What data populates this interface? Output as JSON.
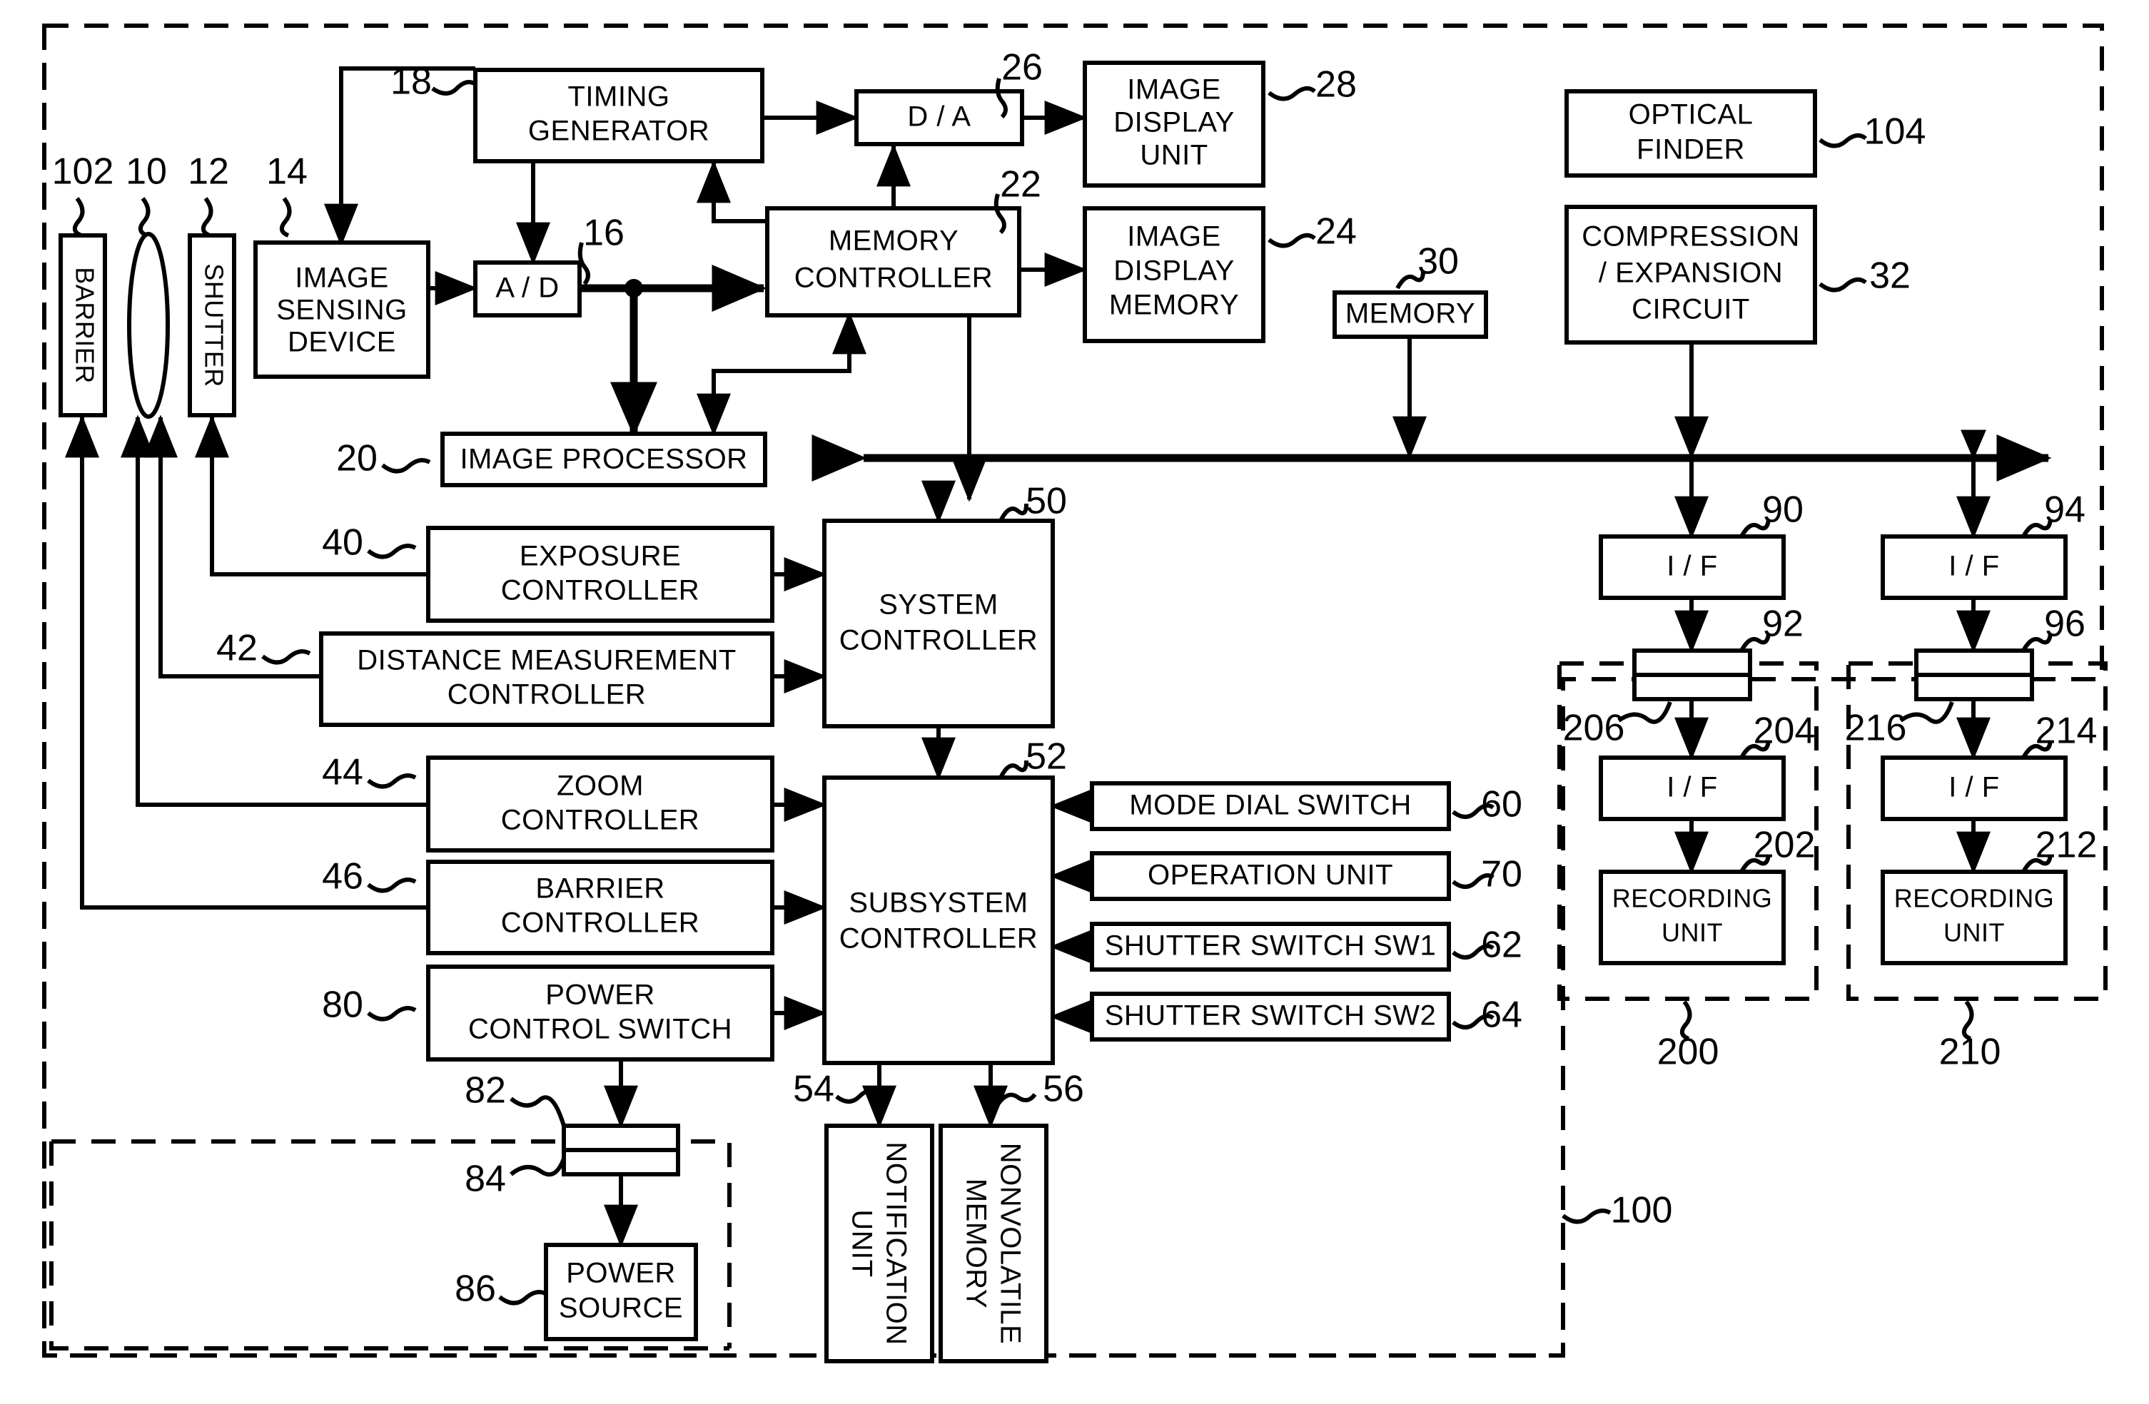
{
  "figure": {
    "type": "patent-block-diagram",
    "title": "Image capturing apparatus block diagram"
  },
  "blocks": {
    "barrier": {
      "label": "BARRIER",
      "ref": "102",
      "orientation": "vertical"
    },
    "lens": {
      "label": "",
      "ref": "10",
      "orientation": "ellipse"
    },
    "shutter": {
      "label": "SHUTTER",
      "ref": "12",
      "orientation": "vertical"
    },
    "image_sensing": {
      "label": "IMAGE SENSING DEVICE",
      "ref": "14"
    },
    "timing_generator": {
      "label": "TIMING GENERATOR",
      "ref": "18"
    },
    "ad": {
      "label": "A / D",
      "ref": "16"
    },
    "da": {
      "label": "D / A",
      "ref": "26"
    },
    "memory_controller": {
      "label": "MEMORY CONTROLLER",
      "ref": "22"
    },
    "image_display_unit": {
      "label": "IMAGE DISPLAY UNIT",
      "ref": "28"
    },
    "image_display_mem": {
      "label": "IMAGE DISPLAY MEMORY",
      "ref": "24"
    },
    "memory": {
      "label": "MEMORY",
      "ref": "30"
    },
    "optical_finder": {
      "label": "OPTICAL FINDER",
      "ref": "104"
    },
    "compression": {
      "label": "COMPRESSION / EXPANSION CIRCUIT",
      "ref": "32"
    },
    "image_processor": {
      "label": "IMAGE PROCESSOR",
      "ref": "20"
    },
    "exposure_ctrl": {
      "label": "EXPOSURE CONTROLLER",
      "ref": "40"
    },
    "distance_ctrl": {
      "label": "DISTANCE MEASUREMENT CONTROLLER",
      "ref": "42"
    },
    "zoom_ctrl": {
      "label": "ZOOM CONTROLLER",
      "ref": "44"
    },
    "barrier_ctrl": {
      "label": "BARRIER CONTROLLER",
      "ref": "46"
    },
    "power_ctrl_switch": {
      "label": "POWER CONTROL SWITCH",
      "ref": "80"
    },
    "system_controller": {
      "label": "SYSTEM CONTROLLER",
      "ref": "50"
    },
    "subsystem_ctrl": {
      "label": "SUBSYSTEM CONTROLLER",
      "ref": "52"
    },
    "mode_dial": {
      "label": "MODE DIAL SWITCH",
      "ref": "60"
    },
    "operation_unit": {
      "label": "OPERATION UNIT",
      "ref": "70"
    },
    "shutter_sw1": {
      "label": "SHUTTER SWITCH SW1",
      "ref": "62"
    },
    "shutter_sw2": {
      "label": "SHUTTER SWITCH SW2",
      "ref": "64"
    },
    "notification_unit": {
      "label": "NOTIFICATION UNIT",
      "ref": "54",
      "orientation": "vertical"
    },
    "nonvolatile_memory": {
      "label": "NONVOLATILE MEMORY",
      "ref": "56",
      "orientation": "vertical"
    },
    "connector_82": {
      "label": "",
      "ref": "82"
    },
    "connector_84": {
      "label": "",
      "ref": "84"
    },
    "power_source": {
      "label": "POWER SOURCE",
      "ref": "86"
    },
    "if_90": {
      "label": "I / F",
      "ref": "90"
    },
    "connector_92": {
      "label": "",
      "ref": "92"
    },
    "if_204": {
      "label": "I / F",
      "ref": "204"
    },
    "connector_206": {
      "label": "",
      "ref": "206"
    },
    "recording_unit_202": {
      "label": "RECORDING UNIT",
      "ref": "202"
    },
    "if_94": {
      "label": "I / F",
      "ref": "94"
    },
    "connector_96": {
      "label": "",
      "ref": "96"
    },
    "if_214": {
      "label": "I / F",
      "ref": "214"
    },
    "connector_216": {
      "label": "",
      "ref": "216"
    },
    "recording_unit_212": {
      "label": "RECORDING UNIT",
      "ref": "212"
    }
  },
  "enclosures": {
    "apparatus_100": {
      "ref": "100"
    },
    "media_200": {
      "ref": "200"
    },
    "media_210": {
      "ref": "210"
    }
  },
  "text_lines": {
    "image_sensing_1": "IMAGE",
    "image_sensing_2": "SENSING",
    "image_sensing_3": "DEVICE",
    "timing_1": "TIMING",
    "timing_2": "GENERATOR",
    "memctl_1": "MEMORY",
    "memctl_2": "CONTROLLER",
    "idu_1": "IMAGE",
    "idu_2": "DISPLAY",
    "idu_3": "UNIT",
    "idm_1": "IMAGE",
    "idm_2": "DISPLAY",
    "idm_3": "MEMORY",
    "of_1": "OPTICAL",
    "of_2": "FINDER",
    "cmp_1": "COMPRESSION",
    "cmp_2": "/ EXPANSION",
    "cmp_3": "CIRCUIT",
    "exp_1": "EXPOSURE",
    "exp_2": "CONTROLLER",
    "dist_1": "DISTANCE MEASUREMENT",
    "dist_2": "CONTROLLER",
    "zoom_1": "ZOOM",
    "zoom_2": "CONTROLLER",
    "bar_1": "BARRIER",
    "bar_2": "CONTROLLER",
    "pcs_1": "POWER",
    "pcs_2": "CONTROL SWITCH",
    "sysc_1": "SYSTEM",
    "sysc_2": "CONTROLLER",
    "subc_1": "SUBSYSTEM",
    "subc_2": "CONTROLLER",
    "ps_1": "POWER",
    "ps_2": "SOURCE",
    "ru_1": "RECORDING",
    "ru_2": "UNIT",
    "notif_1": "NOTIFICATION",
    "notif_2": "UNIT",
    "nvm_1": "NONVOLATILE",
    "nvm_2": "MEMORY"
  }
}
